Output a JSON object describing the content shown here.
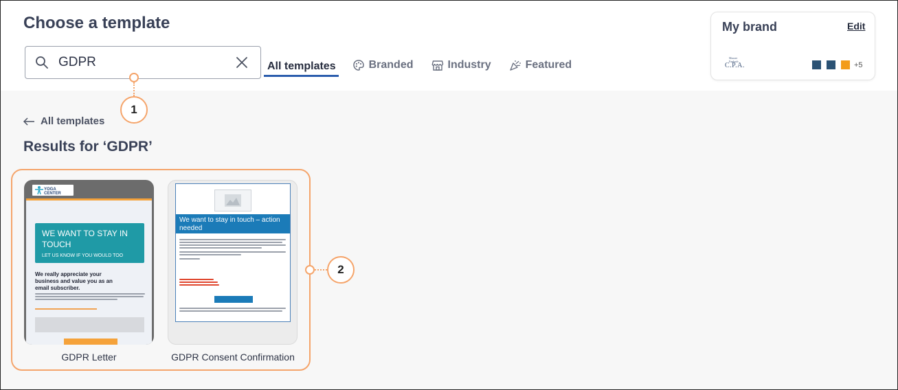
{
  "header": {
    "title": "Choose a template"
  },
  "search": {
    "value": "GDPR",
    "placeholder": ""
  },
  "tabs": [
    {
      "label": "All templates",
      "icon": "none",
      "active": true
    },
    {
      "label": "Branded",
      "icon": "palette-icon",
      "active": false
    },
    {
      "label": "Industry",
      "icon": "storefront-icon",
      "active": false
    },
    {
      "label": "Featured",
      "icon": "party-popper-icon",
      "active": false
    }
  ],
  "brand": {
    "title": "My brand",
    "edit_label": "Edit",
    "logo_text": "C.P.A.",
    "colors": [
      "#2b5274",
      "#2b5274",
      "#f39c1a"
    ],
    "more_colors_label": "+5"
  },
  "results": {
    "back_label": "All templates",
    "title": "Results for ‘GDPR’"
  },
  "templates": [
    {
      "name": "GDPR Letter",
      "preview": {
        "logo": "YOGA CENTER",
        "hero_title": "WE WANT TO STAY IN TOUCH",
        "hero_subtitle": "LET US KNOW IF YOU WOULD TOO",
        "heading": "We really appreciate your business and value you as an email subscriber."
      }
    },
    {
      "name": "GDPR Consent Confirmation",
      "preview": {
        "banner": "We want to stay in touch – action needed"
      }
    }
  ],
  "callouts": [
    "1",
    "2"
  ],
  "colors": {
    "accent": "#2b5dad",
    "callout": "#f5a46a"
  }
}
